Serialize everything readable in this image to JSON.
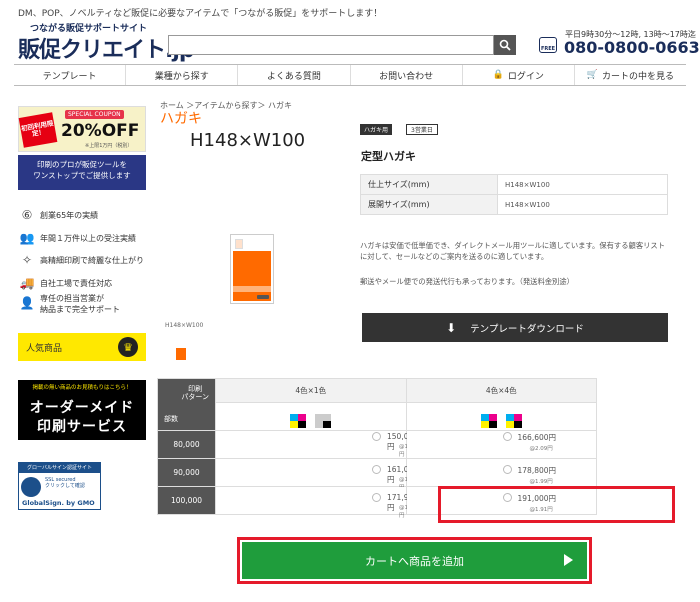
{
  "header": {
    "tagline": "DM、POP、ノベルティなど販促に必要なアイテムで「つながる販促」をサポートします！",
    "logo_sub": "つながる販促サポートサイト",
    "logo_main": "販促クリエイト.jp",
    "search_placeholder": "",
    "free_label": "FREE",
    "hours": "平日9時30分～12時, 13時～17時迄",
    "phone": "080-0800-0663"
  },
  "nav": [
    {
      "label": "テンプレート",
      "icon": ""
    },
    {
      "label": "業種から探す",
      "icon": ""
    },
    {
      "label": "よくある質問",
      "icon": ""
    },
    {
      "label": "お問い合わせ",
      "icon": ""
    },
    {
      "label": "ログイン",
      "icon": "lock-icon"
    },
    {
      "label": "カートの中を見る",
      "icon": "cart-icon"
    }
  ],
  "sidebar": {
    "coupon": {
      "special": "SPECIAL COUPON",
      "badge": "初回利用限定！",
      "off": "20%OFF",
      "note": "※上限1万円（税別）"
    },
    "pro_text_1": "印刷のプロが販促ツールを",
    "pro_text_2": "ワンストップでご提供します",
    "features": [
      {
        "label": "創業65年の実績",
        "icon": "award-icon"
      },
      {
        "label": "年間１万件以上の受注実績",
        "icon": "people-icon"
      },
      {
        "label": "高精細印刷で綺麗な仕上がり",
        "icon": "sparkle-icon"
      },
      {
        "label": "自社工場で責任対応",
        "icon": "factory-icon"
      },
      {
        "label": "専任の担当営業が",
        "label2": "納品まで完全サポート",
        "icon": "person-icon"
      }
    ],
    "popular": "人気商品",
    "order": {
      "top": "掲載の無い商品のお見積もりはこちら！",
      "line1": "オーダーメイド",
      "line2": "印刷サービス"
    },
    "globalsign": {
      "head": "グローバルサイン認証サイト",
      "ssl": "SSL secured",
      "ssl2": "クリックして確認",
      "name": "GlobalSign. by GMO"
    }
  },
  "product": {
    "breadcrumb": "ホーム ＞アイテムから探す＞ ハガキ",
    "title": "ハガキ",
    "size_big": "H148×W100",
    "size_small": "H148×W100"
  },
  "spec": {
    "tag1": "ハガキ用",
    "tag2": "3営業日",
    "title": "定型ハガキ",
    "rows": [
      {
        "key": "仕上サイズ(mm)",
        "value": "H148×W100"
      },
      {
        "key": "展開サイズ(mm)",
        "value": "H148×W100"
      }
    ],
    "desc1": "ハガキは安価で低単価でき、ダイレクトメール用ツールに適しています。保有する顧客リストに対して、セールなどのご案内を送るのに適しています。",
    "desc2": "郵送やメール便での発送代行も承っております。（発送料金別途）",
    "download": "テンプレートダウンロード"
  },
  "price_table": {
    "corner_top_1": "印刷",
    "corner_top_2": "パターン",
    "corner_bottom": "部数",
    "col1": "4色×1色",
    "col2": "4色×4色",
    "rows": [
      {
        "qty": "80,000",
        "p1": "150,000円",
        "u1": "@1.88円",
        "p2": "166,600円",
        "u2": "@2.09円"
      },
      {
        "qty": "90,000",
        "p1": "161,000円",
        "u1": "@1.79円",
        "p2": "178,800円",
        "u2": "@1.99円"
      },
      {
        "qty": "100,000",
        "p1": "171,900円",
        "u1": "@1.72円",
        "p2": "191,000円",
        "u2": "@1.91円"
      }
    ]
  },
  "cart_button": "カートへ商品を追加",
  "colors": {
    "brand_navy": "#1a2d5a",
    "accent_orange": "#ff6a00",
    "cart_green": "#1f9d3c",
    "highlight_red": "#e51a2a"
  }
}
